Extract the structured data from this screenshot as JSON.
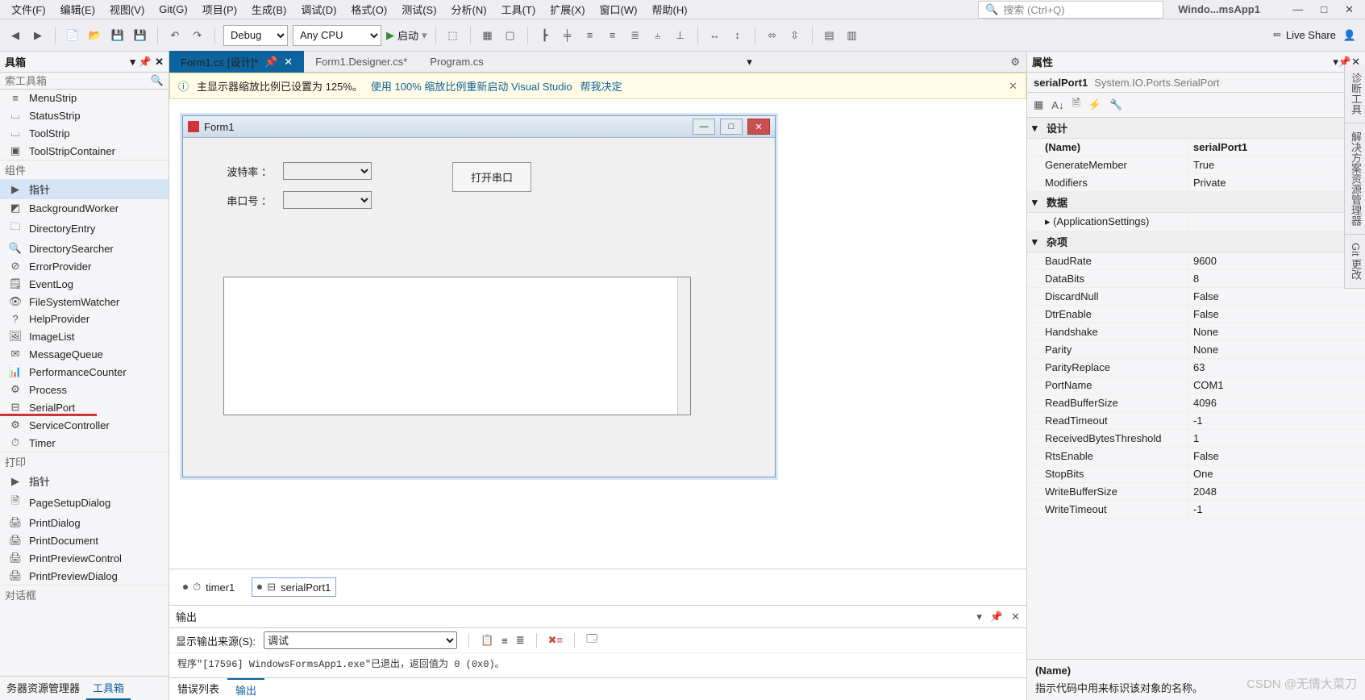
{
  "menu": {
    "items": [
      "文件(F)",
      "编辑(E)",
      "视图(V)",
      "Git(G)",
      "项目(P)",
      "生成(B)",
      "调试(D)",
      "格式(O)",
      "测试(S)",
      "分析(N)",
      "工具(T)",
      "扩展(X)",
      "窗口(W)",
      "帮助(H)"
    ],
    "search_placeholder": "搜索 (Ctrl+Q)",
    "title": "Windo...msApp1"
  },
  "toolbar": {
    "debug": "Debug",
    "cpu": "Any CPU",
    "run": "启动",
    "liveshare": "Live Share"
  },
  "toolbox": {
    "title": "具箱",
    "search_placeholder": "索工具箱",
    "groups": [
      {
        "label": "",
        "items": [
          {
            "icon": "≡",
            "label": "MenuStrip"
          },
          {
            "icon": "⌴",
            "label": "StatusStrip"
          },
          {
            "icon": "⌴",
            "label": "ToolStrip"
          },
          {
            "icon": "▣",
            "label": "ToolStripContainer"
          }
        ]
      },
      {
        "label": "组件",
        "items": [
          {
            "icon": "▶",
            "label": "指针",
            "sel": true
          },
          {
            "icon": "◩",
            "label": "BackgroundWorker"
          },
          {
            "icon": "🗀",
            "label": "DirectoryEntry"
          },
          {
            "icon": "🔍",
            "label": "DirectorySearcher"
          },
          {
            "icon": "⊘",
            "label": "ErrorProvider"
          },
          {
            "icon": "🗒",
            "label": "EventLog"
          },
          {
            "icon": "👁",
            "label": "FileSystemWatcher"
          },
          {
            "icon": "?",
            "label": "HelpProvider"
          },
          {
            "icon": "🖼",
            "label": "ImageList"
          },
          {
            "icon": "✉",
            "label": "MessageQueue"
          },
          {
            "icon": "📊",
            "label": "PerformanceCounter"
          },
          {
            "icon": "⚙",
            "label": "Process"
          },
          {
            "icon": "⊟",
            "label": "SerialPort",
            "ul": true
          },
          {
            "icon": "⚙",
            "label": "ServiceController"
          },
          {
            "icon": "⏱",
            "label": "Timer"
          }
        ]
      },
      {
        "label": "打印",
        "items": [
          {
            "icon": "▶",
            "label": "指针"
          },
          {
            "icon": "🗎",
            "label": "PageSetupDialog"
          },
          {
            "icon": "🖨",
            "label": "PrintDialog"
          },
          {
            "icon": "🖨",
            "label": "PrintDocument"
          },
          {
            "icon": "🖨",
            "label": "PrintPreviewControl"
          },
          {
            "icon": "🖨",
            "label": "PrintPreviewDialog"
          }
        ]
      },
      {
        "label": "对话框",
        "items": []
      }
    ],
    "bottom_tabs": [
      "务器资源管理器",
      "工具箱"
    ],
    "bottom_active": 1
  },
  "doctabs": {
    "tabs": [
      {
        "label": "Form1.cs [设计]*",
        "active": true,
        "pinned": true
      },
      {
        "label": "Form1.Designer.cs*"
      },
      {
        "label": "Program.cs"
      }
    ]
  },
  "infobar": {
    "text": "主显示器缩放比例已设置为 125%。",
    "link1": "使用 100% 缩放比例重新启动 Visual Studio",
    "link2": "帮我决定"
  },
  "form": {
    "title": "Form1",
    "label_baud": "波特率 ：",
    "label_port": "串口号 ：",
    "btn_open": "打开串口"
  },
  "tray": {
    "items": [
      {
        "icon": "⏱",
        "label": "timer1"
      },
      {
        "icon": "⊟",
        "label": "serialPort1",
        "sel": true
      }
    ]
  },
  "output": {
    "title": "输出",
    "source_label": "显示输出来源(S):",
    "source_value": "调试",
    "body": "程序\"[17596] WindowsFormsApp1.exe\"已退出，返回值为 0 (0x0)。",
    "tabs": [
      "错误列表",
      "输出"
    ],
    "active": 1
  },
  "props": {
    "title": "属性",
    "obj": "serialPort1",
    "type": "System.IO.Ports.SerialPort",
    "cats": [
      {
        "name": "设计",
        "rows": [
          {
            "k": "(Name)",
            "v": "serialPort1",
            "bold": true
          },
          {
            "k": "GenerateMember",
            "v": "True"
          },
          {
            "k": "Modifiers",
            "v": "Private"
          }
        ]
      },
      {
        "name": "数据",
        "rows": [
          {
            "k": "(ApplicationSettings)",
            "v": "",
            "exp": true
          }
        ]
      },
      {
        "name": "杂项",
        "rows": [
          {
            "k": "BaudRate",
            "v": "9600"
          },
          {
            "k": "DataBits",
            "v": "8"
          },
          {
            "k": "DiscardNull",
            "v": "False"
          },
          {
            "k": "DtrEnable",
            "v": "False"
          },
          {
            "k": "Handshake",
            "v": "None"
          },
          {
            "k": "Parity",
            "v": "None"
          },
          {
            "k": "ParityReplace",
            "v": "63"
          },
          {
            "k": "PortName",
            "v": "COM1"
          },
          {
            "k": "ReadBufferSize",
            "v": "4096"
          },
          {
            "k": "ReadTimeout",
            "v": "-1"
          },
          {
            "k": "ReceivedBytesThreshold",
            "v": "1"
          },
          {
            "k": "RtsEnable",
            "v": "False"
          },
          {
            "k": "StopBits",
            "v": "One"
          },
          {
            "k": "WriteBufferSize",
            "v": "2048"
          },
          {
            "k": "WriteTimeout",
            "v": "-1"
          }
        ]
      }
    ],
    "help": {
      "name": "(Name)",
      "desc": "指示代码中用来标识该对象的名称。"
    }
  },
  "rdock": [
    "诊断工具",
    "解决方案资源管理器",
    "Git 更改"
  ],
  "watermark": "CSDN @无情大菜刀"
}
